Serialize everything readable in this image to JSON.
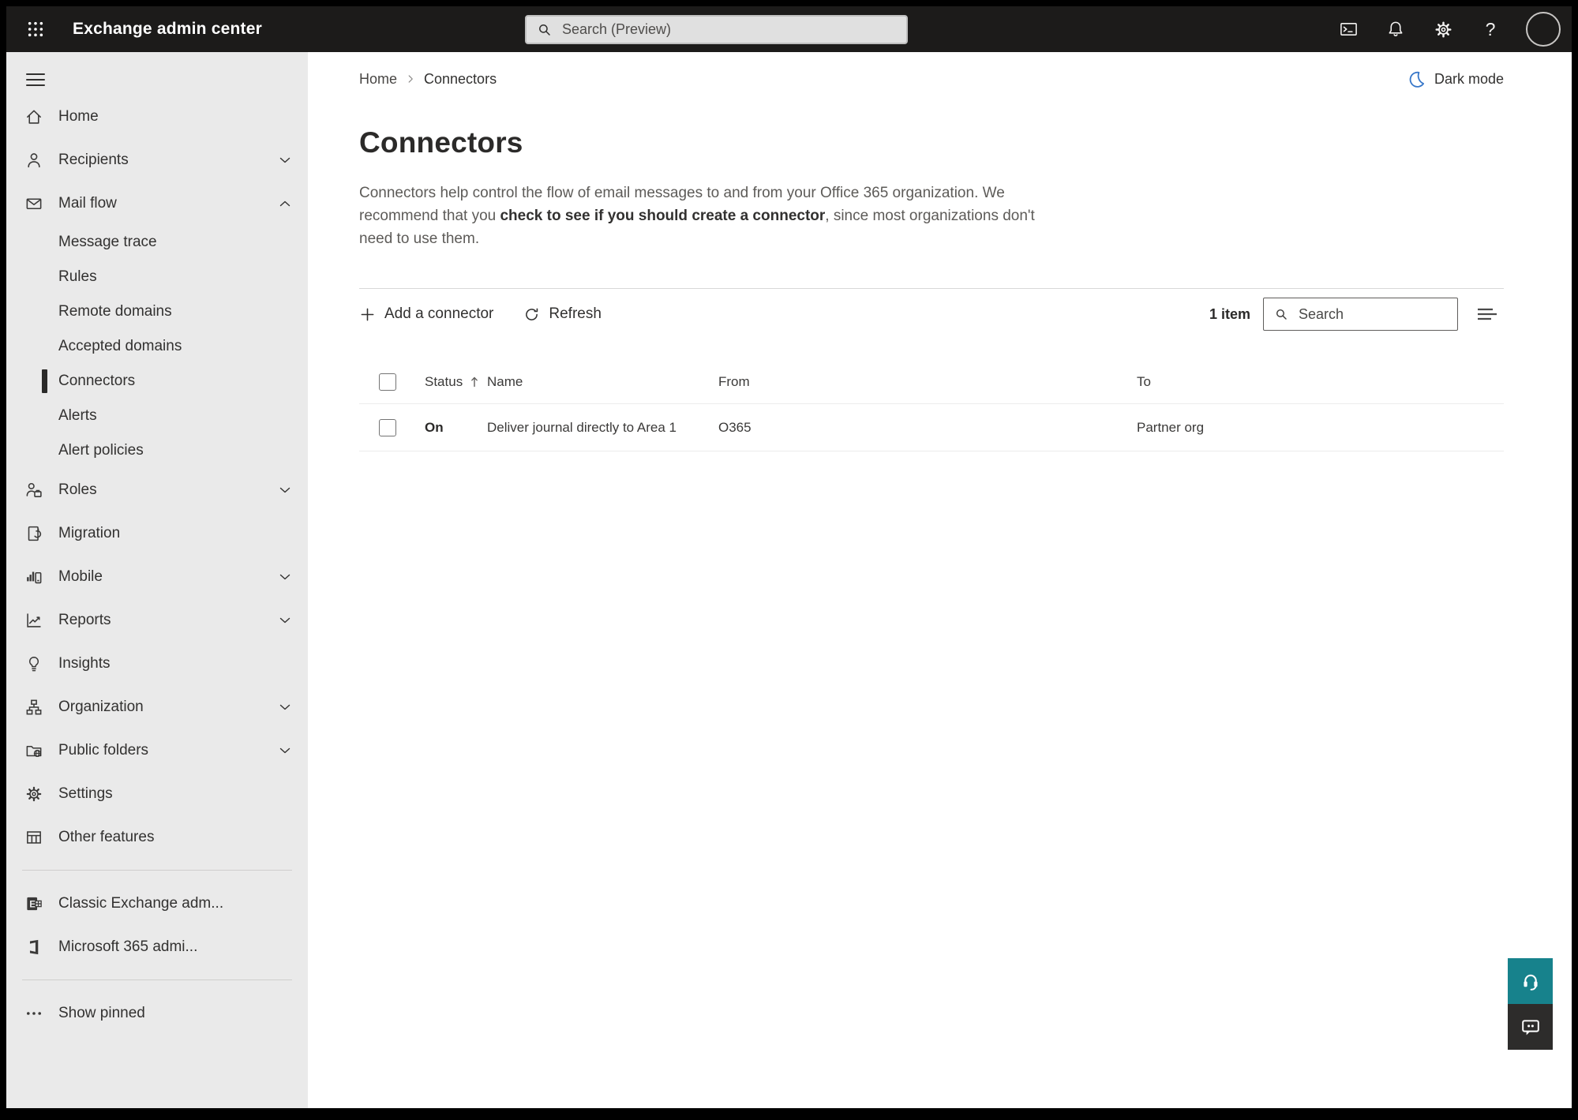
{
  "header": {
    "app_title": "Exchange admin center",
    "search_placeholder": "Search (Preview)",
    "icons": [
      "app-launcher-icon",
      "powershell-terminal-icon",
      "notifications-bell-icon",
      "settings-gear-icon",
      "help-icon",
      "account-avatar"
    ]
  },
  "theme": {
    "header_bg": "#1c1b1a",
    "sidebar_bg": "#eaeaea",
    "accent_blue": "#3777c9",
    "teal": "#17828c",
    "selected_marker": "#2b2a29"
  },
  "sidebar": {
    "items": [
      {
        "label": "Home",
        "icon": "home-icon"
      },
      {
        "label": "Recipients",
        "icon": "person-icon",
        "chevron": "down"
      },
      {
        "label": "Mail flow",
        "icon": "mail-icon",
        "chevron": "up",
        "expanded": true
      },
      {
        "label": "Message trace"
      },
      {
        "label": "Rules"
      },
      {
        "label": "Remote domains"
      },
      {
        "label": "Accepted domains"
      },
      {
        "label": "Connectors",
        "selected": true
      },
      {
        "label": "Alerts"
      },
      {
        "label": "Alert policies"
      },
      {
        "label": "Roles",
        "icon": "roles-icon",
        "chevron": "down"
      },
      {
        "label": "Migration",
        "icon": "migration-icon"
      },
      {
        "label": "Mobile",
        "icon": "mobile-icon",
        "chevron": "down"
      },
      {
        "label": "Reports",
        "icon": "reports-icon",
        "chevron": "down"
      },
      {
        "label": "Insights",
        "icon": "insights-icon"
      },
      {
        "label": "Organization",
        "icon": "organization-icon",
        "chevron": "down"
      },
      {
        "label": "Public folders",
        "icon": "public-folders-icon",
        "chevron": "down"
      },
      {
        "label": "Settings",
        "icon": "settings-icon"
      },
      {
        "label": "Other features",
        "icon": "other-features-icon"
      },
      {
        "label": "Classic Exchange adm...",
        "icon": "classic-exchange-icon"
      },
      {
        "label": "Microsoft 365 admi...",
        "icon": "microsoft-365-icon"
      },
      {
        "label": "Show pinned",
        "icon": "more-dots-icon"
      }
    ]
  },
  "breadcrumb": {
    "home": "Home",
    "current": "Connectors"
  },
  "dark_mode": {
    "label": "Dark mode",
    "icon": "moon-icon"
  },
  "page": {
    "title": "Connectors",
    "description_before": "Connectors help control the flow of email messages to and from your Office 365 organization. We recommend that you ",
    "description_emphasis": "check to see if you should create a connector",
    "description_after": ", since most organizations don't need to use them."
  },
  "toolbar": {
    "add_connector_label": "Add a connector",
    "refresh_label": "Refresh",
    "item_count": "1 item",
    "search_placeholder": "Search"
  },
  "table": {
    "columns": {
      "status": "Status",
      "name": "Name",
      "from": "From",
      "to": "To"
    },
    "sort": {
      "column": "Status",
      "direction": "ascending"
    },
    "rows": [
      {
        "status": "On",
        "name": "Deliver journal directly to Area 1",
        "from": "O365",
        "to": "Partner org"
      }
    ]
  }
}
